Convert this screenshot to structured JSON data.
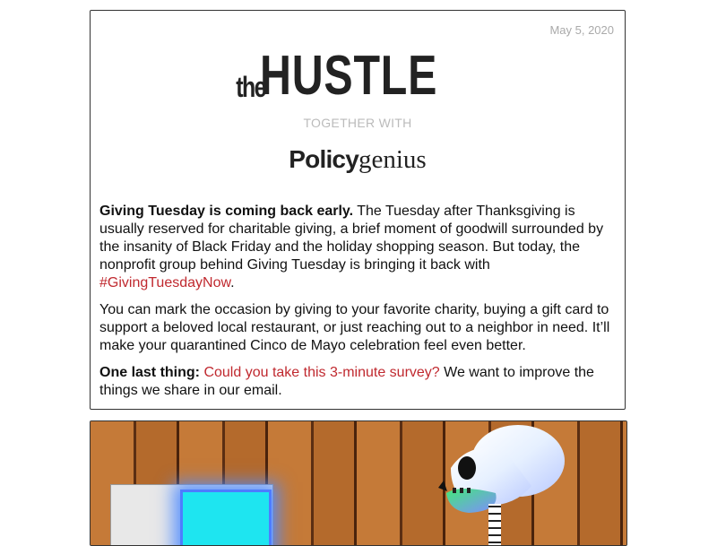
{
  "email": {
    "date": "May 5, 2020",
    "brand_the": "the",
    "brand_word": "HUSTLE",
    "together_with": "TOGETHER WITH",
    "sponsor_bold": "Policy",
    "sponsor_light": "genius"
  },
  "content": {
    "p1_lead": "Giving Tuesday is coming back early.",
    "p1_body": " The Tuesday after Thanksgiving is usually reserved for charitable giving, a brief moment of goodwill surrounded by the insanity of Black Friday and the holiday shopping season. But today, the nonprofit group behind Giving Tuesday is bringing it back with ",
    "p1_link": "#GivingTuesdayNow",
    "p1_end": ".",
    "p2": "You can mark the occasion by giving to your favorite charity, buying a gift card to support a beloved local restaurant, or just reaching out to a neighbor in need. It’ll make your quarantined Cinco de Mayo celebration feel even better.",
    "p3_lead": "One last thing:",
    "p3_link": "Could you take this 3-minute survey?",
    "p3_body": " We want to improve the things we share in our email."
  },
  "colors": {
    "link": "#c0292f",
    "text": "#111111",
    "muted": "#aaaaaa"
  }
}
